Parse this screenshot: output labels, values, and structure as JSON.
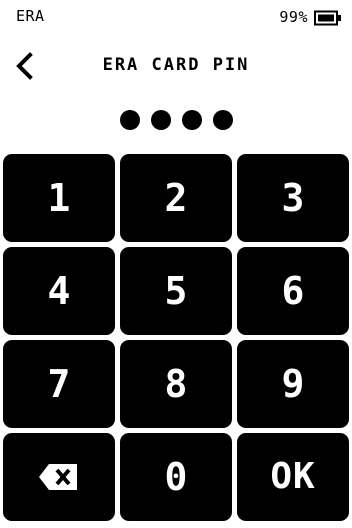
{
  "status_bar": {
    "carrier": "ERA",
    "battery_percent": "99%",
    "battery_icon": "battery-icon"
  },
  "header": {
    "back_icon": "chevron-left-icon",
    "title": "ERA CARD PIN"
  },
  "pin": {
    "entered_digits": 4
  },
  "keypad": {
    "keys": [
      {
        "label": "1"
      },
      {
        "label": "2"
      },
      {
        "label": "3"
      },
      {
        "label": "4"
      },
      {
        "label": "5"
      },
      {
        "label": "6"
      },
      {
        "label": "7"
      },
      {
        "label": "8"
      },
      {
        "label": "9"
      },
      {
        "icon": "backspace-icon"
      },
      {
        "label": "0"
      },
      {
        "label": "OK"
      }
    ]
  }
}
